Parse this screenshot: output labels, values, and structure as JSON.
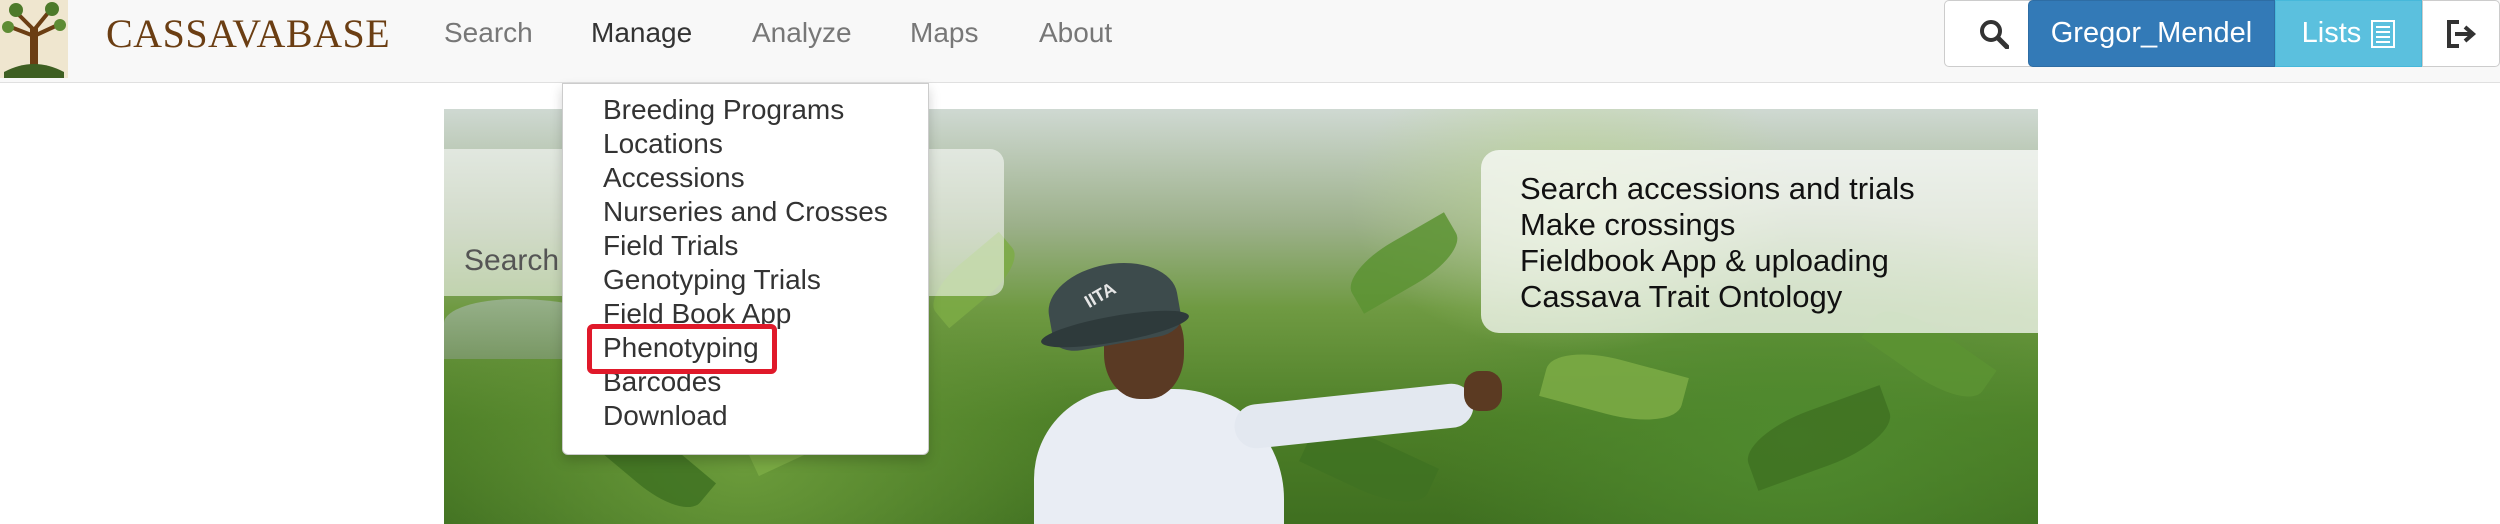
{
  "navbar": {
    "brand": "CASSAVABASE",
    "links": [
      {
        "label": "Search"
      },
      {
        "label": "Manage"
      },
      {
        "label": "Analyze"
      },
      {
        "label": "Maps"
      },
      {
        "label": "About"
      }
    ],
    "search_icon": "magnifier-icon",
    "user_button_label": "Gregor_Mendel",
    "lists_button_label": "Lists",
    "lists_icon": "list-document-icon",
    "logout_icon": "logout-icon"
  },
  "manage_menu": {
    "items": [
      {
        "label": "Breeding Programs"
      },
      {
        "label": "Locations"
      },
      {
        "label": "Accessions"
      },
      {
        "label": "Nurseries and Crosses"
      },
      {
        "label": "Field Trials"
      },
      {
        "label": "Genotyping Trials"
      },
      {
        "label": "Field Book App"
      },
      {
        "label": "Phenotyping"
      },
      {
        "label": "Barcodes"
      },
      {
        "label": "Download"
      }
    ],
    "highlighted": "Phenotyping",
    "highlight_color": "#e0192a"
  },
  "hero": {
    "left_panel_text": "Search accessions and trials",
    "right_panel_items": [
      "Search accessions and trials",
      "Make crossings",
      "Fieldbook App & uploading",
      "Cassava Trait Ontology"
    ],
    "hat_text": "IITA"
  },
  "colors": {
    "brand": "#6b3e13",
    "primary": "#337ab7",
    "info": "#5bc0de"
  }
}
